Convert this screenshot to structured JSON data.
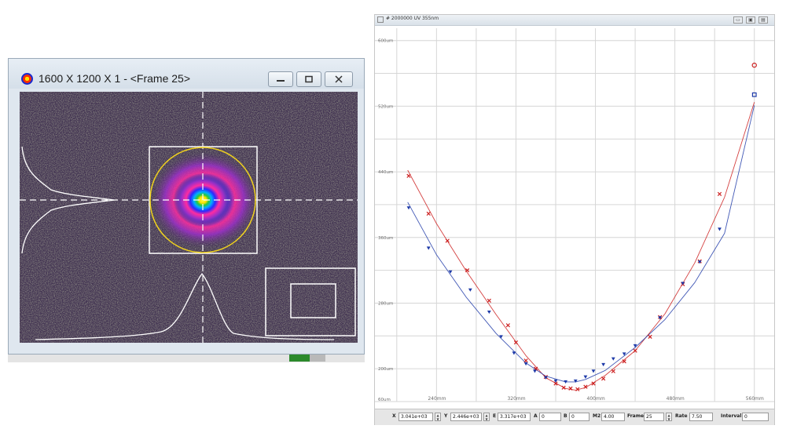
{
  "left_window": {
    "title": "1600 X 1200 X 1 - <Frame 25>",
    "icon": "beam-app-icon",
    "buttons": {
      "minimize": "minimize-icon",
      "maximize": "maximize-icon",
      "close": "close-icon"
    },
    "colors": {
      "ring": "#f0d21e",
      "crosshair": "#ffffff",
      "background": "#453656"
    }
  },
  "right_window": {
    "title": "# 2000000 UV 355nm",
    "buttons": {
      "restore": "▭",
      "maximize": "▣",
      "close": "▤"
    }
  },
  "toolbar": {
    "x_label": "X",
    "x_value": "3.041e+03",
    "y_label": "Y",
    "y_value": "2.446e+03",
    "e_label": "E",
    "e_value": "3.317e+03",
    "a_label": "A",
    "a_value": "0",
    "b_label": "B",
    "b_value": "0",
    "m2_label": "M2",
    "m2_value": "4.00",
    "frame_label": "Frame",
    "frame_value": "25",
    "rate_label": "Rate",
    "rate_value": "7.50",
    "interval_label": "Interval",
    "interval_value": "0"
  },
  "chart_data": {
    "type": "scatter",
    "title": "",
    "xlabel": "",
    "ylabel": "",
    "x_ticks": [
      "240mm",
      "320mm",
      "400mm",
      "480mm",
      "560mm"
    ],
    "y_ticks": [
      "60um",
      "200um",
      "280um",
      "360um",
      "440um",
      "520um",
      "600um"
    ],
    "xlim": [
      178,
      580
    ],
    "ylim": [
      160,
      615
    ],
    "grid": true,
    "colors": {
      "red": "#cc1e1e",
      "blue": "#1e3aa8",
      "grid": "#d6d6d6"
    },
    "series": [
      {
        "marker": "x",
        "color": "#cc1e1e",
        "x": [
          212,
          232,
          251,
          271,
          293,
          312,
          320,
          330,
          340,
          350,
          360,
          368,
          375,
          382,
          390,
          398,
          408,
          418,
          429,
          440,
          455,
          465,
          488,
          505,
          525,
          560
        ],
        "y": [
          435,
          389,
          356,
          320,
          283,
          253,
          232,
          210,
          200,
          190,
          182,
          177,
          176,
          175,
          178,
          182,
          188,
          197,
          209,
          222,
          239,
          263,
          303,
          331,
          413,
          570
        ],
        "fit_x": [
          211,
          240,
          270,
          300,
          330,
          350,
          370,
          380,
          390,
          410,
          440,
          470,
          500,
          530,
          560
        ],
        "fit_y": [
          442,
          377,
          319,
          266,
          216,
          189,
          176,
          174,
          177,
          192,
          222,
          267,
          329,
          409,
          525
        ]
      },
      {
        "marker": "triangle",
        "color": "#1e3aa8",
        "x": [
          212,
          232,
          254,
          274,
          293,
          305,
          318,
          330,
          339,
          350,
          360,
          370,
          380,
          390,
          398,
          408,
          418,
          429,
          440,
          465,
          488,
          505,
          525,
          560
        ],
        "y": [
          396,
          347,
          318,
          296,
          269,
          239,
          219,
          206,
          197,
          189,
          185,
          184,
          185,
          190,
          197,
          205,
          212,
          218,
          228,
          262,
          304,
          330,
          370,
          534
        ],
        "fit_x": [
          211,
          240,
          270,
          300,
          330,
          350,
          370,
          380,
          390,
          410,
          440,
          470,
          500,
          530,
          560
        ],
        "fit_y": [
          403,
          339,
          287,
          243,
          207,
          191,
          184,
          184,
          187,
          198,
          226,
          260,
          305,
          365,
          521
        ]
      }
    ]
  }
}
